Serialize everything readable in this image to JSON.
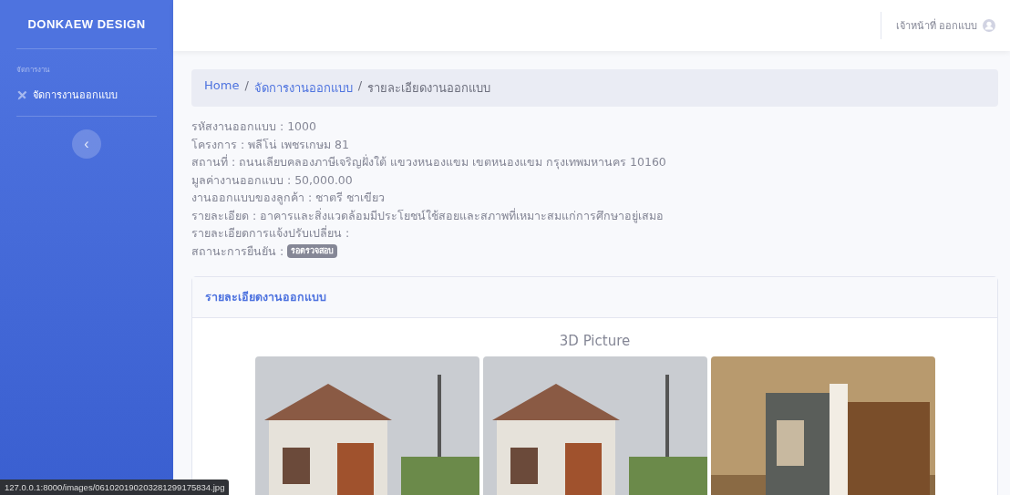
{
  "sidebar": {
    "brand": "DONKAEW DESIGN",
    "section_heading": "จัดการงาน",
    "items": [
      {
        "label": "จัดการงานออกแบบ",
        "selected": false
      }
    ],
    "toggle_button": "‹"
  },
  "topbar": {
    "user_name": "เจ้าหน้าที่ ออกแบบ"
  },
  "breadcrumb": [
    {
      "label": "Home",
      "kind": "link"
    },
    {
      "separator": "/",
      "label": "จัดการงานออกแบบ",
      "kind": "link"
    },
    {
      "separator": "/",
      "label": "รายละเอียดงานออกแบบ",
      "kind": "current"
    }
  ],
  "details": [
    "รหัสงานออกแบบ : 1000",
    "โครงการ : พลีโน่ เพชรเกษม 81",
    "สถานที่ : ถนนเลียบคลองภาษีเจริญฝั่งใต้ แขวงหนองแขม เขตหนองแขม กรุงเทพมหานคร 10160",
    "มูลค่างานออกแบบ : 50,000.00",
    "งานออกแบบของลูกค้า : ชาตรี ชาเขียว",
    "รายละเอียด : อาคารและสิ่งแวดล้อมมีประโยชน์ใช้สอยและสภาพที่เหมาะสมแก่การศึกษาอยู่เสมอ",
    "รายละเอียดการแจ้งปรับเปลี่ยน :"
  ],
  "status": {
    "label": "สถานะการยืนยัน :",
    "badge": "รอตรวจสอบ"
  },
  "card": {
    "title": "รายละเอียดงานออกแบบ",
    "subtitle": "3D Picture",
    "photos": [
      {
        "kind": "house"
      },
      {
        "kind": "house"
      },
      {
        "kind": "interior"
      }
    ]
  },
  "status_bar": {
    "url": "127.0.0.1:8000/images/061020190203281299175834.jpg"
  }
}
